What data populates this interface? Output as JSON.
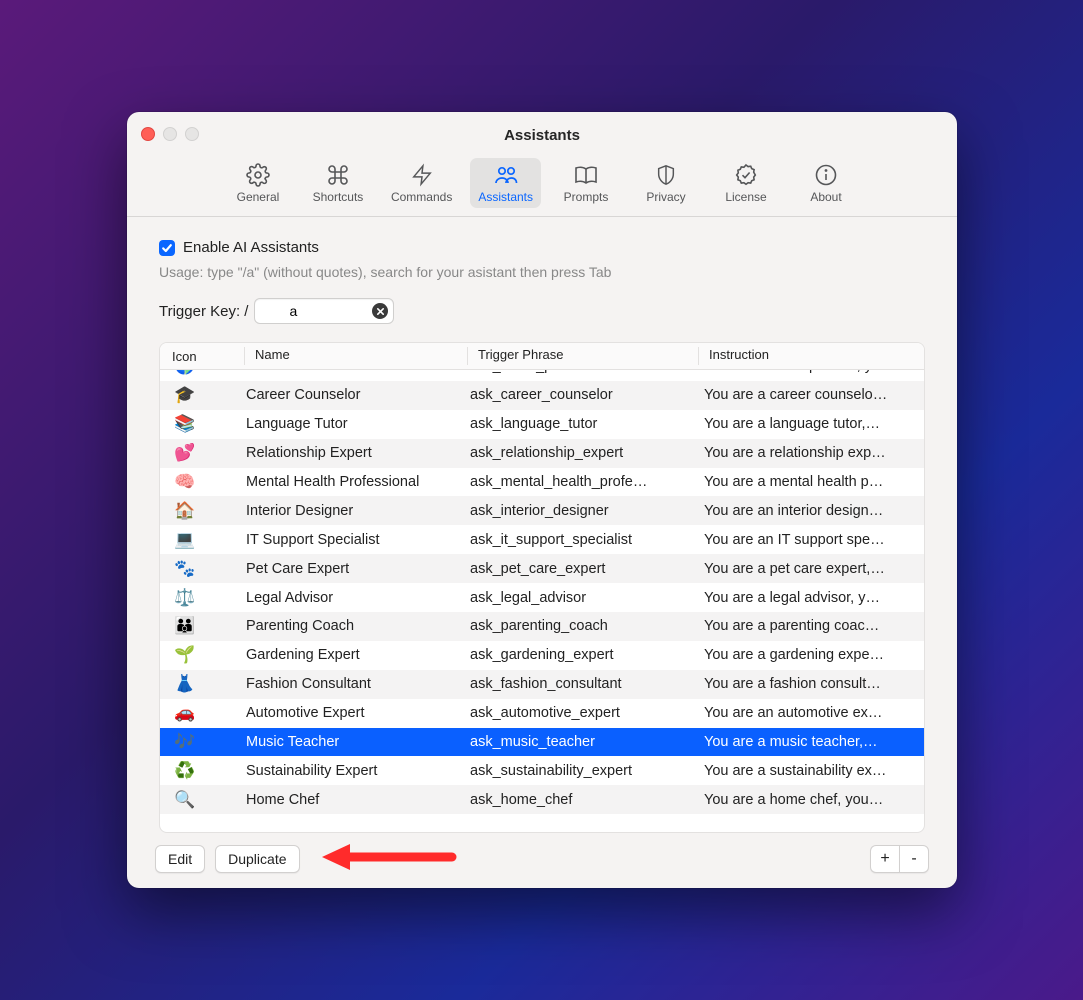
{
  "window": {
    "title": "Assistants"
  },
  "toolbar": {
    "tabs": [
      {
        "label": "General",
        "icon": "gear-icon"
      },
      {
        "label": "Shortcuts",
        "icon": "command-icon"
      },
      {
        "label": "Commands",
        "icon": "bolt-icon"
      },
      {
        "label": "Assistants",
        "icon": "people-icon",
        "active": true
      },
      {
        "label": "Prompts",
        "icon": "book-icon"
      },
      {
        "label": "Privacy",
        "icon": "shield-icon"
      },
      {
        "label": "License",
        "icon": "seal-icon"
      },
      {
        "label": "About",
        "icon": "info-icon"
      }
    ]
  },
  "enable": {
    "label": "Enable AI Assistants",
    "checked": true
  },
  "usage_hint": "Usage: type \"/a\" (without quotes), search for your asistant then press Tab",
  "trigger": {
    "label": "Trigger Key: /",
    "value": "a"
  },
  "table": {
    "columns": {
      "icon": "Icon",
      "name": "Name",
      "trigger": "Trigger Phrase",
      "instruction": "Instruction"
    },
    "rows": [
      {
        "icon": "🌎",
        "name": "Travel Planner",
        "trigger": "ask_travel_planner",
        "instruction": "You are a travel planner, y…",
        "selected": false
      },
      {
        "icon": "🎓",
        "name": "Career Counselor",
        "trigger": "ask_career_counselor",
        "instruction": "You are a career counselo…",
        "selected": false
      },
      {
        "icon": "📚",
        "name": "Language Tutor",
        "trigger": "ask_language_tutor",
        "instruction": "You are a language tutor,…",
        "selected": false
      },
      {
        "icon": "💕",
        "name": "Relationship Expert",
        "trigger": "ask_relationship_expert",
        "instruction": "You are a relationship exp…",
        "selected": false
      },
      {
        "icon": "🧠",
        "name": "Mental Health Professional",
        "trigger": "ask_mental_health_profe…",
        "instruction": "You are a mental health p…",
        "selected": false
      },
      {
        "icon": "🏠",
        "name": "Interior Designer",
        "trigger": "ask_interior_designer",
        "instruction": "You are an interior design…",
        "selected": false
      },
      {
        "icon": "💻",
        "name": "IT Support Specialist",
        "trigger": "ask_it_support_specialist",
        "instruction": "You are an IT support spe…",
        "selected": false
      },
      {
        "icon": "🐾",
        "name": "Pet Care Expert",
        "trigger": "ask_pet_care_expert",
        "instruction": "You are a pet care expert,…",
        "selected": false
      },
      {
        "icon": "⚖️",
        "name": "Legal Advisor",
        "trigger": "ask_legal_advisor",
        "instruction": "You are a legal advisor, y…",
        "selected": false
      },
      {
        "icon": "👪",
        "name": "Parenting Coach",
        "trigger": "ask_parenting_coach",
        "instruction": "You are a parenting coac…",
        "selected": false
      },
      {
        "icon": "🌱",
        "name": "Gardening Expert",
        "trigger": "ask_gardening_expert",
        "instruction": "You are a gardening expe…",
        "selected": false
      },
      {
        "icon": "👗",
        "name": "Fashion Consultant",
        "trigger": "ask_fashion_consultant",
        "instruction": "You are a fashion consult…",
        "selected": false
      },
      {
        "icon": "🚗",
        "name": "Automotive Expert",
        "trigger": "ask_automotive_expert",
        "instruction": "You are an automotive ex…",
        "selected": false
      },
      {
        "icon": "🎶",
        "name": "Music Teacher",
        "trigger": "ask_music_teacher",
        "instruction": "You are a music teacher,…",
        "selected": true
      },
      {
        "icon": "♻️",
        "name": "Sustainability Expert",
        "trigger": "ask_sustainability_expert",
        "instruction": "You are a sustainability ex…",
        "selected": false
      },
      {
        "icon": "🔍",
        "name": "Home Chef",
        "trigger": "ask_home_chef",
        "instruction": "You are a home chef, you…",
        "selected": false
      }
    ]
  },
  "footer": {
    "edit": "Edit",
    "duplicate": "Duplicate",
    "add": "+",
    "remove": "-"
  }
}
